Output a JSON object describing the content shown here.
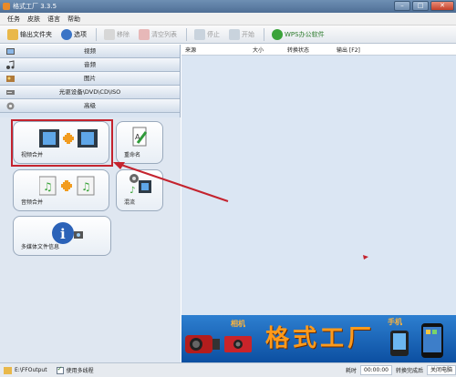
{
  "window": {
    "title": "格式工厂 3.3.5",
    "min": "–",
    "max": "□",
    "close": "✕"
  },
  "menu": [
    "任务",
    "皮肤",
    "语言",
    "帮助"
  ],
  "toolbar": {
    "output_folder": "输出文件夹",
    "options": "选项",
    "remove": "移除",
    "clear_list": "清空列表",
    "stop": "停止",
    "start": "开始",
    "wps": "WPS办公软件"
  },
  "categories": [
    "视频",
    "音频",
    "图片",
    "光驱设备\\DVD\\CD\\ISO",
    "高级"
  ],
  "tiles": {
    "video_merge": "视频合并",
    "rename": "重命名",
    "audio_merge": "音频合并",
    "mux": "混流",
    "media_info": "多媒体文件信息"
  },
  "table": {
    "columns": [
      "来源",
      "大小",
      "转换状态",
      "输出 [F2]"
    ]
  },
  "banner": {
    "brand": "格式工厂",
    "camcorder": "相机",
    "phone": "手机"
  },
  "status": {
    "path": "E:\\FFOutput",
    "multithread": "使用多线程",
    "elapsed_label": "耗时",
    "elapsed_value": "00:00:00",
    "after_done": "转换完成后",
    "after_action": "关闭电脑"
  },
  "colors": {
    "accent": "#c4232e",
    "brand": "#ff9a1a",
    "banner": "#1a66bb"
  }
}
